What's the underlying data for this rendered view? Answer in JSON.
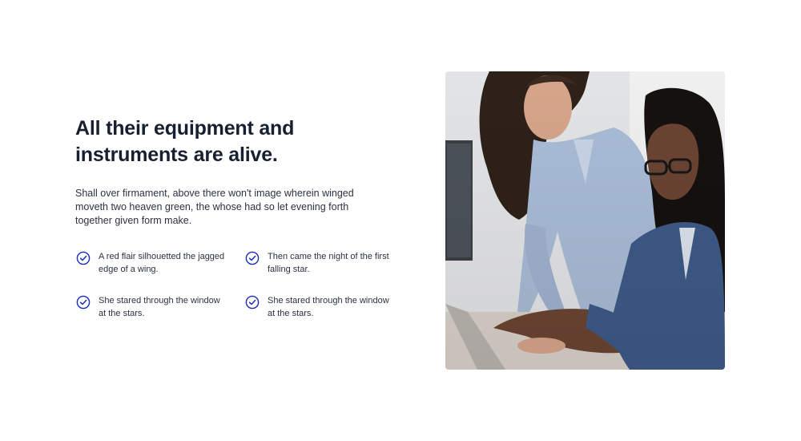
{
  "section": {
    "heading": "All their equipment and instruments are alive.",
    "lead": "Shall over firmament, above there won't image wherein winged moveth two heaven green, the whose had so let evening forth together given form make.",
    "features": [
      {
        "icon": "check-circle-icon",
        "text": "A red flair silhouetted the jagged edge of a wing."
      },
      {
        "icon": "check-circle-icon",
        "text": "Then came the night of the first falling star."
      },
      {
        "icon": "check-circle-icon",
        "text": "She stared through the window at the stars."
      },
      {
        "icon": "check-circle-icon",
        "text": "She stared through the window at the stars."
      }
    ],
    "image": {
      "alt": "Two women looking at a tablet"
    },
    "accent_color": "#1b2bb8"
  }
}
